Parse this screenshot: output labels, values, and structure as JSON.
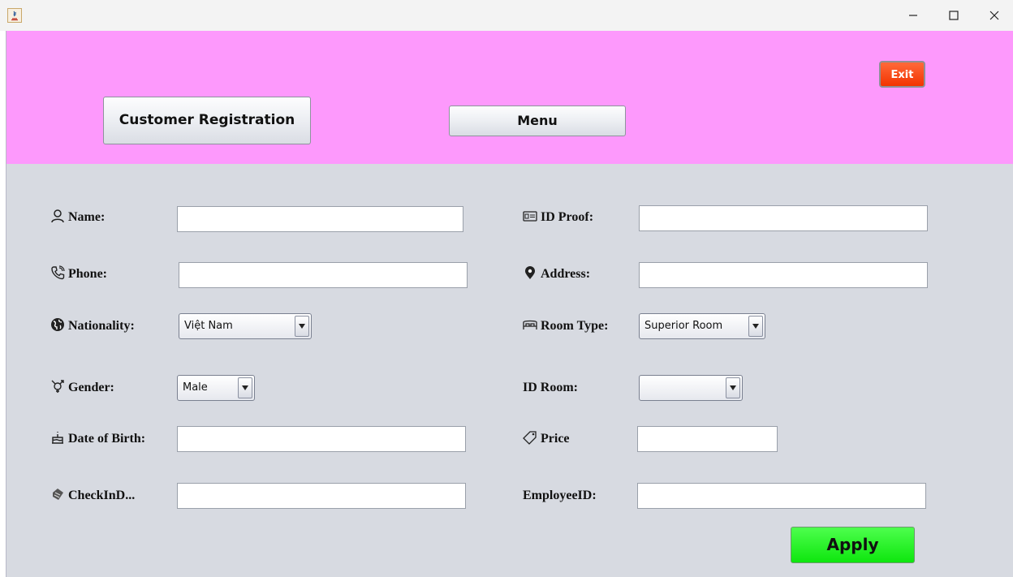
{
  "window": {
    "app_icon": "java-app-icon",
    "controls": [
      "minimize-icon",
      "maximize-icon",
      "close-icon"
    ]
  },
  "header": {
    "background": "#fd99fc",
    "customer_registration_label": "Customer Registration",
    "menu_label": "Menu",
    "exit_label": "Exit",
    "exit_color": "#f23300"
  },
  "form": {
    "background": "#d7dae1",
    "name": {
      "label": "Name:",
      "icon": "user-icon",
      "value": ""
    },
    "phone": {
      "label": "Phone:",
      "icon": "phone-icon",
      "value": ""
    },
    "nationality": {
      "label": "Nationality:",
      "icon": "globe-icon",
      "value": "Việt Nam"
    },
    "gender": {
      "label": "Gender:",
      "icon": "gender-icon",
      "value": "Male"
    },
    "date_of_birth": {
      "label": "Date of Birth:",
      "icon": "cake-icon",
      "value": ""
    },
    "checkin": {
      "label": "CheckInD...",
      "icon": "calendar-icon",
      "value": ""
    },
    "id_proof": {
      "label": "ID Proof:",
      "icon": "id-card-icon",
      "value": ""
    },
    "address": {
      "label": "Address:",
      "icon": "location-pin-icon",
      "value": ""
    },
    "room_type": {
      "label": "Room Type:",
      "icon": "bed-icon",
      "value": "Superior Room"
    },
    "id_room": {
      "label": "ID Room:",
      "value": ""
    },
    "price": {
      "label": "Price",
      "icon": "price-tag-icon",
      "value": ""
    },
    "employee_id": {
      "label": "EmployeeID:",
      "value": ""
    }
  },
  "apply_button": {
    "label": "Apply",
    "color": "#0ee60e"
  }
}
